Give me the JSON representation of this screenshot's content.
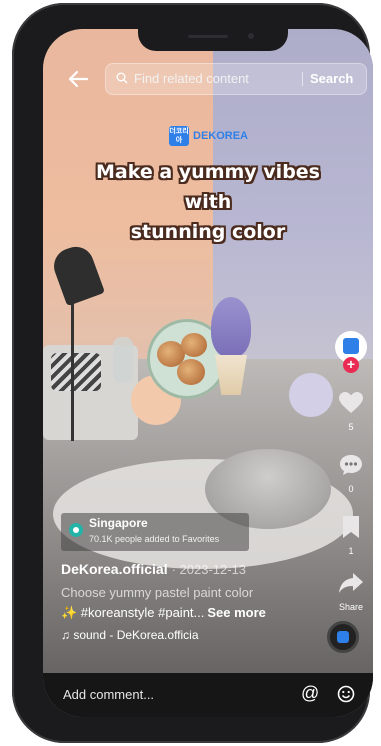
{
  "search": {
    "placeholder": "Find related content",
    "button": "Search"
  },
  "brand": {
    "logo_text": "더코리아",
    "name": "DEKOREA"
  },
  "video": {
    "headline_line1": "Make a yummy vibes with",
    "headline_line2": "stunning color"
  },
  "rail": {
    "likes": "5",
    "comments": "0",
    "favorites": "1",
    "share_label": "Share"
  },
  "location": {
    "city": "Singapore",
    "favorites_note": "70.1K people added to Favorites"
  },
  "post": {
    "author": "DeKorea.official",
    "date": "· 2023-12-13",
    "desc_line1": "Choose yummy pastel paint color",
    "desc_line2": "✨ #koreanstyle #paint...",
    "see_more": "See more",
    "sound": "♫ sound - DeKorea.officia"
  },
  "comment": {
    "placeholder": "Add comment..."
  },
  "colors": {
    "accent": "#2f7fe8",
    "follow": "#ea2c55",
    "location_pin": "#22b4a6"
  },
  "icons": [
    "back-arrow-icon",
    "search-icon",
    "heart-icon",
    "comment-icon",
    "bookmark-icon",
    "share-icon",
    "music-disc-icon",
    "at-icon",
    "emoji-icon",
    "location-pin-icon"
  ]
}
